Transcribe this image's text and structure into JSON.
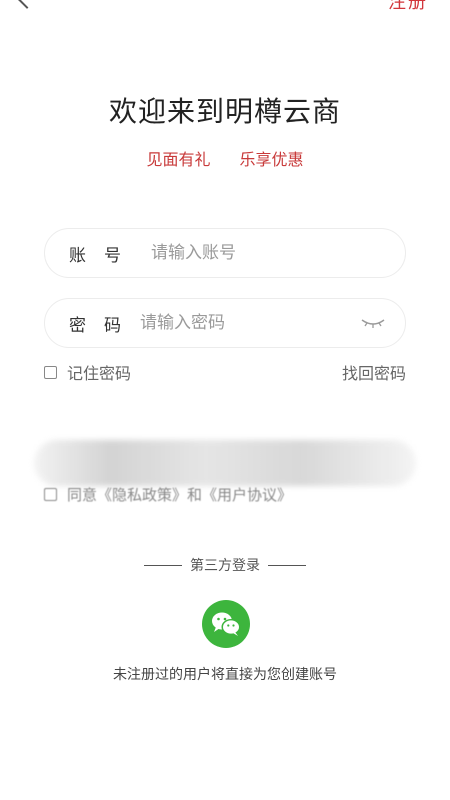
{
  "header": {
    "register_label": "注册"
  },
  "welcome": {
    "title": "欢迎来到明樽云商",
    "tagline_left": "见面有礼",
    "tagline_right": "乐享优惠"
  },
  "login_form": {
    "account_label": "账号",
    "account_placeholder": "请输入账号",
    "password_label": "密码",
    "password_placeholder": "请输入密码",
    "remember_label": "记住密码",
    "forgot_label": "找回密码",
    "agreement_text": "同意《隐私政策》和《用户协议》"
  },
  "third_party": {
    "heading": "第三方登录",
    "note": "未注册过的用户将直接为您创建账号",
    "wechat_color": "#3db53d"
  },
  "colors": {
    "accent": "#d2363b"
  }
}
